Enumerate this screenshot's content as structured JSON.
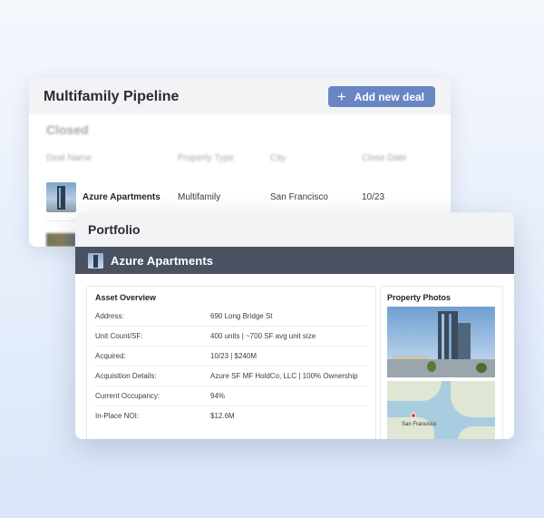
{
  "pipeline": {
    "title": "Multifamily Pipeline",
    "add_button_label": "Add new deal",
    "add_button_icon": "plus-icon",
    "section": "Closed",
    "columns": [
      "Deal Name",
      "Property Type",
      "City",
      "Close Date"
    ],
    "rows": [
      {
        "name": "Azure Apartments",
        "type": "Multifamily",
        "city": "San Francisco",
        "close_date": "10/23"
      }
    ]
  },
  "portfolio": {
    "title": "Portfolio",
    "property_name": "Azure Apartments",
    "asset_overview": {
      "title": "Asset Overview",
      "rows": [
        {
          "label": "Address:",
          "value": "690 Long Bridge St"
        },
        {
          "label": "Unit Count/SF:",
          "value": "400 units | ~700 SF avg unit size"
        },
        {
          "label": "Acquired:",
          "value": "10/23 | $240M"
        },
        {
          "label": "Acquisition Details:",
          "value": "Azure SF MF HoldCo, LLC | 100% Ownership"
        },
        {
          "label": "Current Occupancy:",
          "value": "94%"
        },
        {
          "label": "In-Place NOI:",
          "value": "$12.6M"
        }
      ]
    },
    "photos": {
      "title": "Property Photos",
      "map_label": "San Francisco"
    }
  },
  "colors": {
    "accent": "#6a85c4",
    "property_bar": "#4a5161",
    "header_bg": "#f2f3f5"
  }
}
